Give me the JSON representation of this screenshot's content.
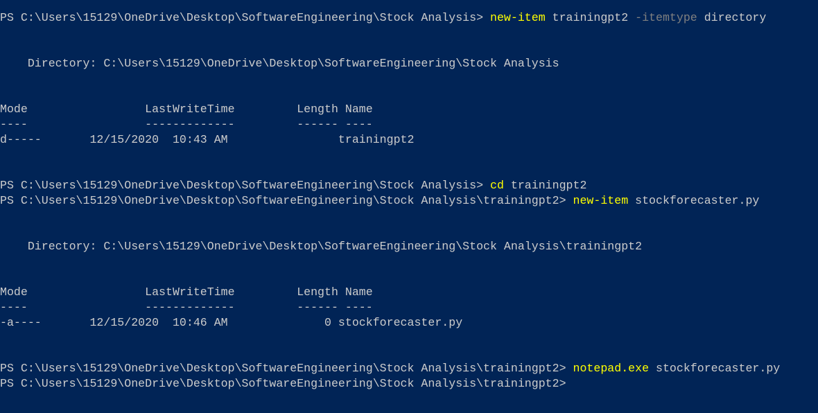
{
  "colors": {
    "background": "#012456",
    "text": "#cccccc",
    "command": "#ffff00",
    "parameter": "#808080"
  },
  "lines": [
    [
      {
        "t": "PS C:\\Users\\15129\\OneDrive\\Desktop\\SoftwareEngineering\\Stock Analysis> ",
        "k": "txt"
      },
      {
        "t": "new-item",
        "k": "cmd"
      },
      {
        "t": " trainingpt2 ",
        "k": "txt"
      },
      {
        "t": "-itemtype",
        "k": "param"
      },
      {
        "t": " directory",
        "k": "txt"
      }
    ],
    [],
    [],
    [
      {
        "t": "    Directory: C:\\Users\\15129\\OneDrive\\Desktop\\SoftwareEngineering\\Stock Analysis",
        "k": "txt"
      }
    ],
    [],
    [],
    [
      {
        "t": "Mode                 LastWriteTime         Length Name",
        "k": "txt"
      }
    ],
    [
      {
        "t": "----                 -------------         ------ ----",
        "k": "txt"
      }
    ],
    [
      {
        "t": "d-----       12/15/2020  10:43 AM                trainingpt2",
        "k": "txt"
      }
    ],
    [],
    [],
    [
      {
        "t": "PS C:\\Users\\15129\\OneDrive\\Desktop\\SoftwareEngineering\\Stock Analysis> ",
        "k": "txt"
      },
      {
        "t": "cd",
        "k": "cmd"
      },
      {
        "t": " trainingpt2",
        "k": "txt"
      }
    ],
    [
      {
        "t": "PS C:\\Users\\15129\\OneDrive\\Desktop\\SoftwareEngineering\\Stock Analysis\\trainingpt2> ",
        "k": "txt"
      },
      {
        "t": "new-item",
        "k": "cmd"
      },
      {
        "t": " stockforecaster.py",
        "k": "txt"
      }
    ],
    [],
    [],
    [
      {
        "t": "    Directory: C:\\Users\\15129\\OneDrive\\Desktop\\SoftwareEngineering\\Stock Analysis\\trainingpt2",
        "k": "txt"
      }
    ],
    [],
    [],
    [
      {
        "t": "Mode                 LastWriteTime         Length Name",
        "k": "txt"
      }
    ],
    [
      {
        "t": "----                 -------------         ------ ----",
        "k": "txt"
      }
    ],
    [
      {
        "t": "-a----       12/15/2020  10:46 AM              0 stockforecaster.py",
        "k": "txt"
      }
    ],
    [],
    [],
    [
      {
        "t": "PS C:\\Users\\15129\\OneDrive\\Desktop\\SoftwareEngineering\\Stock Analysis\\trainingpt2> ",
        "k": "txt"
      },
      {
        "t": "notepad.exe",
        "k": "cmd"
      },
      {
        "t": " stockforecaster.py",
        "k": "txt"
      }
    ],
    [
      {
        "t": "PS C:\\Users\\15129\\OneDrive\\Desktop\\SoftwareEngineering\\Stock Analysis\\trainingpt2>",
        "k": "txt"
      }
    ]
  ]
}
